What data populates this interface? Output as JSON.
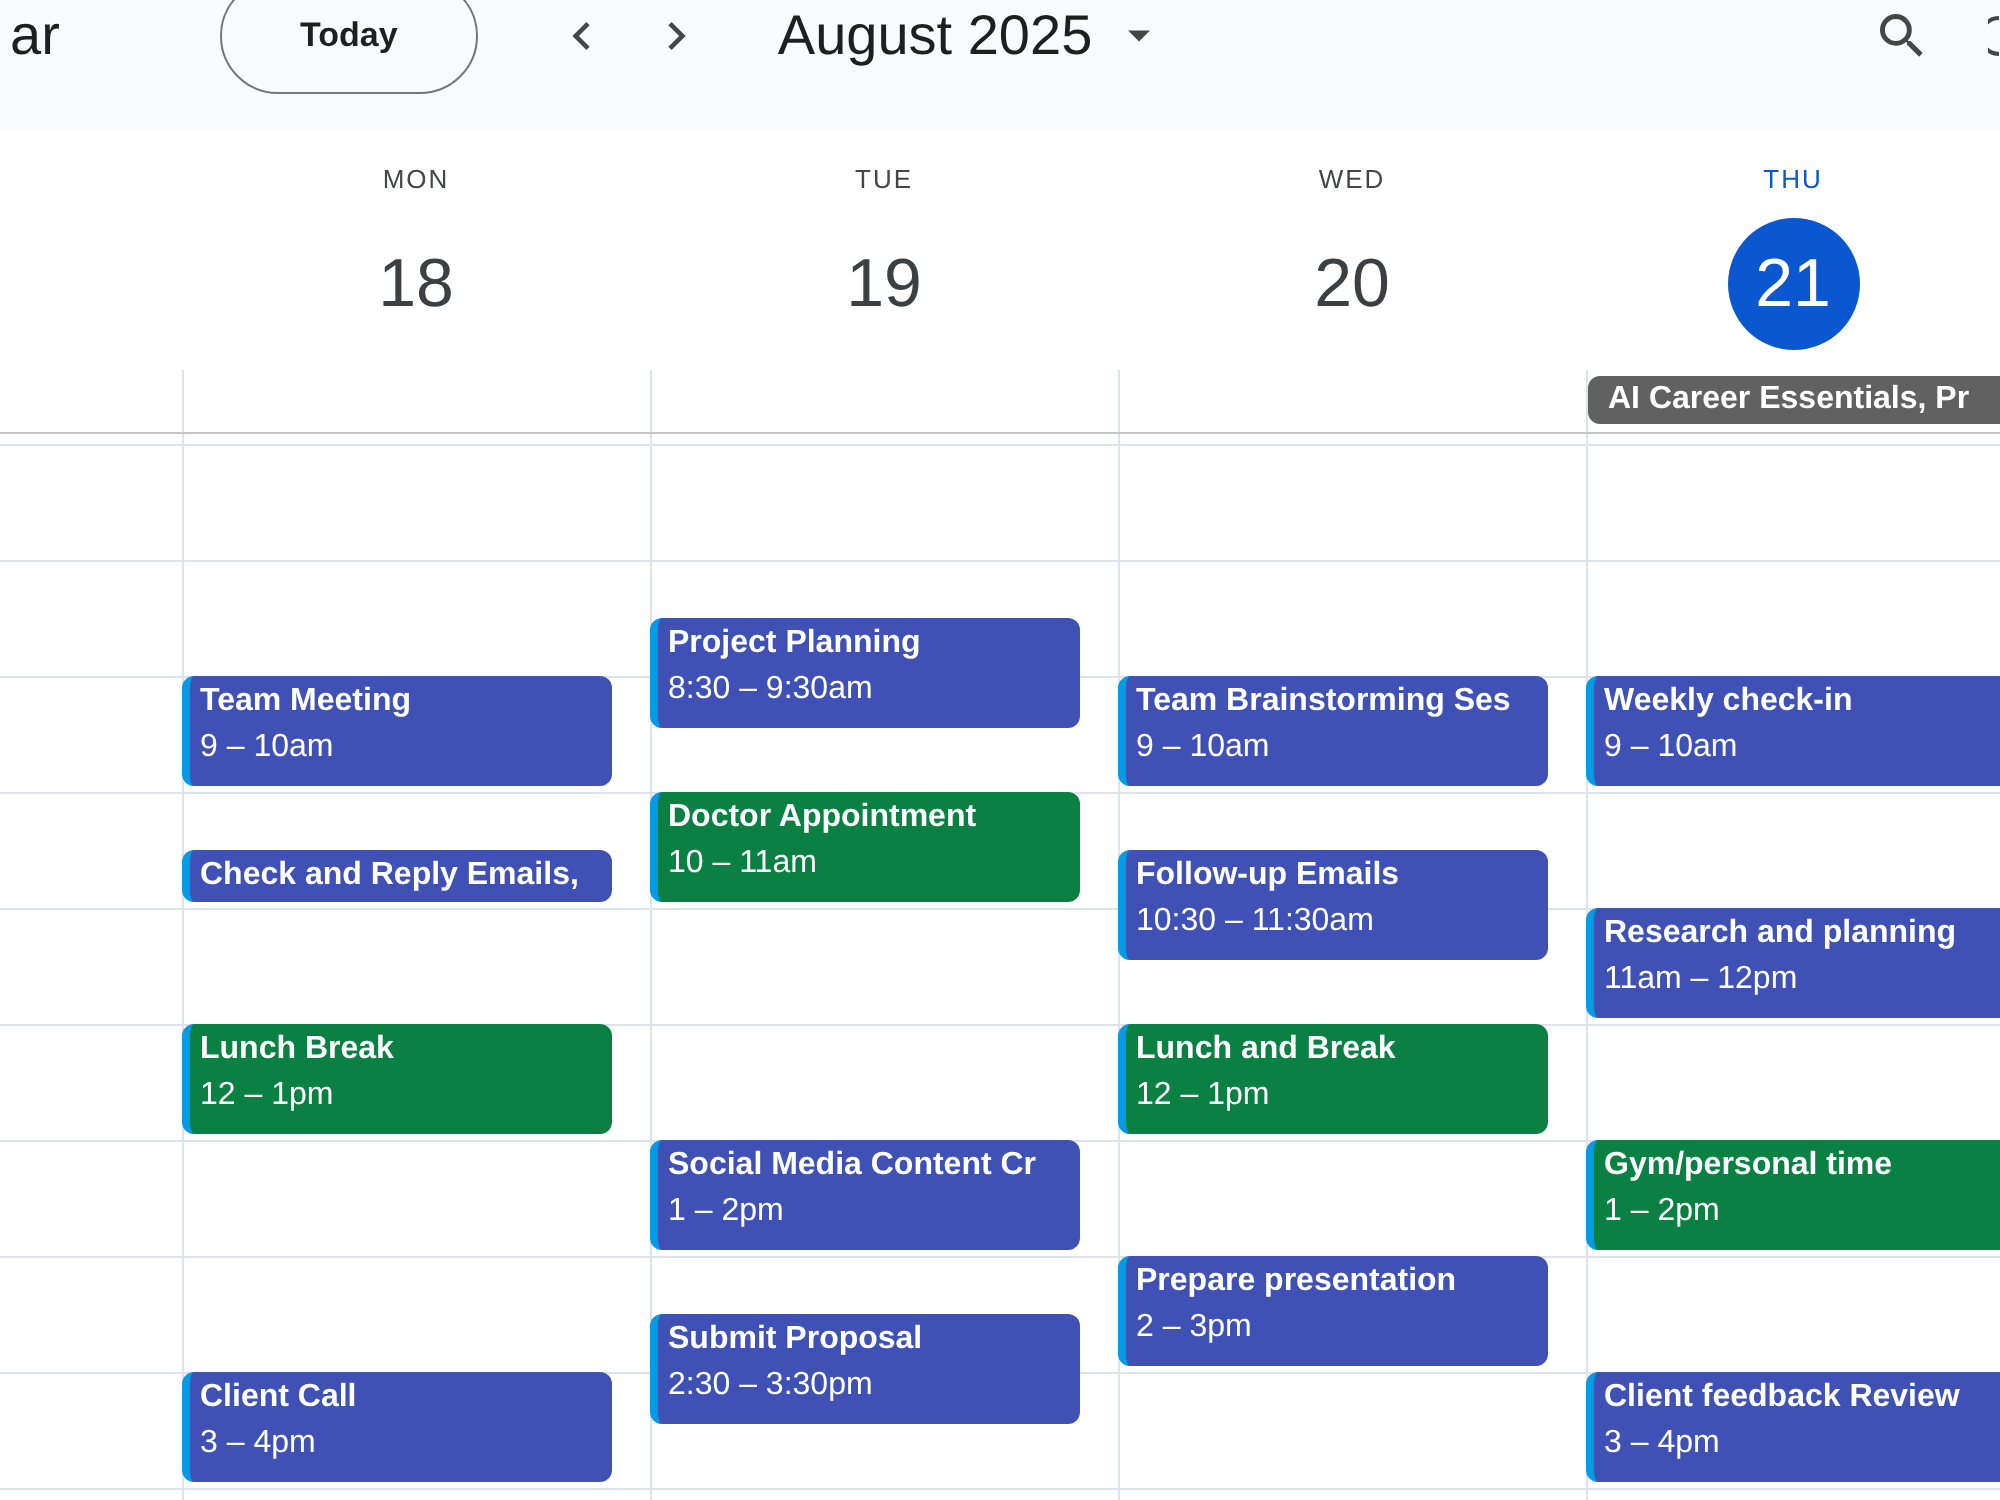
{
  "top_bar": {
    "app_title": "ar",
    "today_button": "Today",
    "month_title": "August 2025"
  },
  "days": [
    {
      "weekday": "MON",
      "date": "18",
      "today": false,
      "events": [
        {
          "title": "Team Meeting",
          "time": "9 – 10am",
          "color": "#3f51b5"
        },
        {
          "title": "Check and Reply Emails,",
          "color": "#3f51b5"
        },
        {
          "title": "Lunch Break",
          "time": "12 – 1pm",
          "color": "#0b8043"
        },
        {
          "title": "Client Call",
          "time": "3 – 4pm",
          "color": "#3f51b5"
        }
      ]
    },
    {
      "weekday": "TUE",
      "date": "19",
      "today": false,
      "events": [
        {
          "title": "Project Planning",
          "time": "8:30 – 9:30am",
          "color": "#3f51b5"
        },
        {
          "title": "Doctor Appointment",
          "time": "10 – 11am",
          "color": "#0b8043"
        },
        {
          "title": "Social Media Content Cr",
          "time": "1 – 2pm",
          "color": "#3f51b5"
        },
        {
          "title": "Submit Proposal",
          "time": "2:30 – 3:30pm",
          "color": "#3f51b5"
        }
      ]
    },
    {
      "weekday": "WED",
      "date": "20",
      "today": false,
      "events": [
        {
          "title": "Team Brainstorming Ses",
          "time": "9 – 10am",
          "color": "#3f51b5"
        },
        {
          "title": "Follow-up Emails",
          "time": "10:30 – 11:30am",
          "color": "#3f51b5"
        },
        {
          "title": "Lunch and Break",
          "time": "12 – 1pm",
          "color": "#0b8043"
        },
        {
          "title": "Prepare presentation",
          "time": "2 – 3pm",
          "color": "#3f51b5"
        }
      ]
    },
    {
      "weekday": "THU",
      "date": "21",
      "today": true,
      "all_day": [
        {
          "title": "AI Career Essentials, Pr"
        }
      ],
      "events": [
        {
          "title": "Weekly check-in",
          "time": "9 – 10am",
          "color": "#3f51b5"
        },
        {
          "title": "Research and planning",
          "time": "11am – 12pm",
          "color": "#3f51b5"
        },
        {
          "title": "Gym/personal time",
          "time": "1 – 2pm",
          "color": "#0b8043"
        },
        {
          "title": "Client feedback Review",
          "time": "3 – 4pm",
          "color": "#3f51b5"
        }
      ]
    }
  ]
}
